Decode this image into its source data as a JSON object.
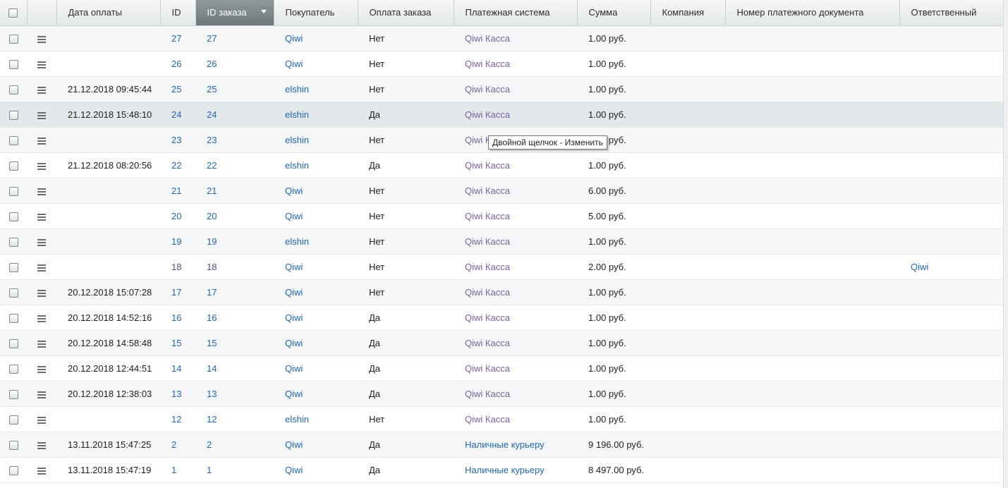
{
  "columns": [
    "Дата оплаты",
    "ID",
    "ID заказа",
    "Покупатель",
    "Оплата заказа",
    "Платежная система",
    "Сумма",
    "Компания",
    "Номер платежного документа",
    "Ответственный"
  ],
  "rows": [
    {
      "date": "",
      "id": "27",
      "order": "27",
      "buyer": "Qiwi",
      "paid": "Нет",
      "system": "Qiwi Касса",
      "sum": "1.00 руб.",
      "resp": ""
    },
    {
      "date": "",
      "id": "26",
      "order": "26",
      "buyer": "Qiwi",
      "paid": "Нет",
      "system": "Qiwi Касса",
      "sum": "1.00 руб.",
      "resp": ""
    },
    {
      "date": "21.12.2018 09:45:44",
      "id": "25",
      "order": "25",
      "buyer": "elshin",
      "paid": "Нет",
      "system": "Qiwi Касса",
      "sum": "1.00 руб.",
      "resp": ""
    },
    {
      "date": "21.12.2018 15:48:10",
      "id": "24",
      "order": "24",
      "buyer": "elshin",
      "paid": "Да",
      "system": "Qiwi Касса",
      "sum": "1.00 руб.",
      "resp": ""
    },
    {
      "date": "",
      "id": "23",
      "order": "23",
      "buyer": "elshin",
      "paid": "Нет",
      "system": "Qiwi Касса",
      "sum": "1.00 руб.",
      "resp": ""
    },
    {
      "date": "21.12.2018 08:20:56",
      "id": "22",
      "order": "22",
      "buyer": "elshin",
      "paid": "Да",
      "system": "Qiwi Касса",
      "sum": "1.00 руб.",
      "resp": ""
    },
    {
      "date": "",
      "id": "21",
      "order": "21",
      "buyer": "Qiwi",
      "paid": "Нет",
      "system": "Qiwi Касса",
      "sum": "6.00 руб.",
      "resp": ""
    },
    {
      "date": "",
      "id": "20",
      "order": "20",
      "buyer": "Qiwi",
      "paid": "Нет",
      "system": "Qiwi Касса",
      "sum": "5.00 руб.",
      "resp": ""
    },
    {
      "date": "",
      "id": "19",
      "order": "19",
      "buyer": "elshin",
      "paid": "Нет",
      "system": "Qiwi Касса",
      "sum": "1.00 руб.",
      "resp": ""
    },
    {
      "date": "",
      "id": "18",
      "order": "18",
      "buyer": "Qiwi",
      "paid": "Нет",
      "system": "Qiwi Касса",
      "sum": "2.00 руб.",
      "resp": "Qiwi"
    },
    {
      "date": "20.12.2018 15:07:28",
      "id": "17",
      "order": "17",
      "buyer": "Qiwi",
      "paid": "Нет",
      "system": "Qiwi Касса",
      "sum": "1.00 руб.",
      "resp": ""
    },
    {
      "date": "20.12.2018 14:52:16",
      "id": "16",
      "order": "16",
      "buyer": "Qiwi",
      "paid": "Да",
      "system": "Qiwi Касса",
      "sum": "1.00 руб.",
      "resp": ""
    },
    {
      "date": "20.12.2018 14:58:48",
      "id": "15",
      "order": "15",
      "buyer": "Qiwi",
      "paid": "Да",
      "system": "Qiwi Касса",
      "sum": "1.00 руб.",
      "resp": ""
    },
    {
      "date": "20.12.2018 12:44:51",
      "id": "14",
      "order": "14",
      "buyer": "Qiwi",
      "paid": "Да",
      "system": "Qiwi Касса",
      "sum": "1.00 руб.",
      "resp": ""
    },
    {
      "date": "20.12.2018 12:38:03",
      "id": "13",
      "order": "13",
      "buyer": "Qiwi",
      "paid": "Да",
      "system": "Qiwi Касса",
      "sum": "1.00 руб.",
      "resp": ""
    },
    {
      "date": "",
      "id": "12",
      "order": "12",
      "buyer": "elshin",
      "paid": "Нет",
      "system": "Qiwi Касса",
      "sum": "1.00 руб.",
      "resp": ""
    },
    {
      "date": "13.11.2018 15:47:25",
      "id": "2",
      "order": "2",
      "buyer": "Qiwi",
      "paid": "Да",
      "system": "Наличные курьеру",
      "sum": "9 196.00 руб.",
      "resp": ""
    },
    {
      "date": "13.11.2018 15:47:19",
      "id": "1",
      "order": "1",
      "buyer": "Qiwi",
      "paid": "Да",
      "system": "Наличные курьеру",
      "sum": "8 497.00 руб.",
      "resp": ""
    }
  ],
  "tooltip": "Двойной щелчок - Изменить",
  "colors": {
    "link": "#2067b0",
    "payment_link": "#7d5fa0",
    "header_sorted": "#7a8487"
  }
}
